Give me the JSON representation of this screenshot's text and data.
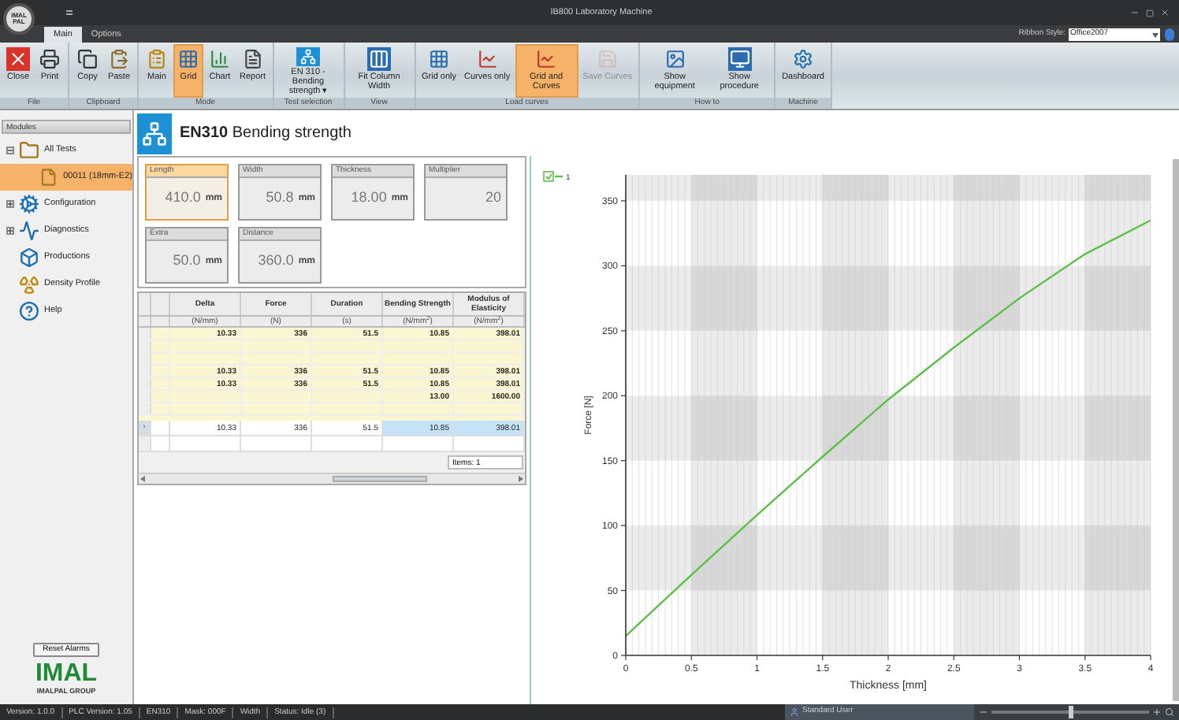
{
  "window": {
    "title": "IB800 Laboratory Machine",
    "logo": [
      "IMAL",
      "PAL"
    ]
  },
  "tabs": [
    {
      "label": "Main",
      "selected": true
    },
    {
      "label": "Options",
      "selected": false
    }
  ],
  "ribbon_style": {
    "label": "Ribbon Style:",
    "value": "Office2007"
  },
  "ribbon": [
    {
      "label": "File",
      "buttons": [
        {
          "label": "Close",
          "selected": false,
          "disabled": false
        },
        {
          "label": "Print",
          "selected": false,
          "disabled": false
        }
      ]
    },
    {
      "label": "Clipboard",
      "buttons": [
        {
          "label": "Copy",
          "selected": false,
          "disabled": false
        },
        {
          "label": "Paste",
          "selected": false,
          "disabled": false
        }
      ]
    },
    {
      "label": "Mode",
      "buttons": [
        {
          "label": "Main",
          "selected": false,
          "disabled": false
        },
        {
          "label": "Grid",
          "selected": true,
          "disabled": false
        },
        {
          "label": "Chart",
          "selected": false,
          "disabled": false
        },
        {
          "label": "Report",
          "selected": false,
          "disabled": false
        }
      ]
    },
    {
      "label": "Test selection",
      "buttons": [
        {
          "label": "EN 310 - Bending strength ▾",
          "selected": false,
          "disabled": false
        }
      ]
    },
    {
      "label": "View",
      "buttons": [
        {
          "label": "Fit Column Width",
          "selected": false,
          "disabled": false
        }
      ]
    },
    {
      "label": "Load curves",
      "buttons": [
        {
          "label": "Grid only",
          "selected": false,
          "disabled": false
        },
        {
          "label": "Curves only",
          "selected": false,
          "disabled": false
        },
        {
          "label": "Grid and Curves",
          "selected": true,
          "disabled": false
        },
        {
          "label": "Save Curves",
          "selected": false,
          "disabled": true
        }
      ]
    },
    {
      "label": "How to",
      "buttons": [
        {
          "label": "Show equipment",
          "selected": false,
          "disabled": false
        },
        {
          "label": "Show procedure",
          "selected": false,
          "disabled": false
        }
      ]
    },
    {
      "label": "Machine",
      "buttons": [
        {
          "label": "Dashboard",
          "selected": false,
          "disabled": false
        }
      ]
    }
  ],
  "sidebar": {
    "title": "Modules",
    "items": [
      {
        "label": "All Tests",
        "expanded": true,
        "children": [
          {
            "label": "00011 (18mm-E2)",
            "selected": true
          }
        ]
      },
      {
        "label": "Configuration",
        "expanded": false
      },
      {
        "label": "Diagnostics",
        "expanded": false
      },
      {
        "label": "Productions"
      },
      {
        "label": "Density Profile"
      },
      {
        "label": "Help"
      }
    ],
    "reset_button": "Reset Alarms",
    "brand": "IMAL",
    "brand_group": "IMALPAL GROUP"
  },
  "heading": {
    "code": "EN310",
    "title": "Bending strength"
  },
  "parameters": [
    [
      {
        "label": "Length",
        "value": "410.0",
        "unit": "mm",
        "selected": true
      },
      {
        "label": "Width",
        "value": "50.8",
        "unit": "mm",
        "selected": false
      },
      {
        "label": "Thickness",
        "value": "18.00",
        "unit": "mm",
        "selected": false
      },
      {
        "label": "Multiplier",
        "value": "20",
        "selected": false
      }
    ],
    [
      {
        "label": "Extra",
        "value": "50.0",
        "unit": "mm",
        "selected": false
      },
      {
        "label": "Distance",
        "value": "360.0",
        "unit": "mm",
        "selected": false
      }
    ]
  ],
  "table": {
    "columns": [
      {
        "name": "Delta",
        "unit": "(N/mm)"
      },
      {
        "name": "Force",
        "unit": "(N)"
      },
      {
        "name": "Duration",
        "unit": "(s)"
      },
      {
        "name": "Bending Strength",
        "unit": "(N/mm$^{2}$)"
      },
      {
        "name": "Modulus of Elasticity",
        "unit": "(N/mm$^{2}$)"
      }
    ],
    "summary_rows": [
      [
        "10.33",
        "336",
        "51.5",
        "10.85",
        "398.01"
      ],
      [],
      [],
      [
        "10.33",
        "336",
        "51.5",
        "10.85",
        "398.01"
      ],
      [
        "10.33",
        "336",
        "51.5",
        "10.85",
        "398.01"
      ],
      [
        "",
        "",
        "",
        "13.00",
        "1600.00"
      ],
      []
    ],
    "rows": [
      {
        "cells": [
          "10.33",
          "336",
          "51.5",
          "10.85",
          "398.01"
        ],
        "selected": true,
        "marker": "›"
      },
      {
        "cells": [],
        "selected": false
      }
    ],
    "footer": "Items: 1"
  },
  "chart_data": {
    "type": "line",
    "xlabel": "Thickness [mm]",
    "ylabel": "Force [N]",
    "x": [
      0,
      0.5,
      1,
      1.5,
      2,
      2.5,
      3,
      3.5,
      4
    ],
    "series": [
      {
        "name": "1",
        "color": "#5cbf4a",
        "values": [
          15,
          62,
          108,
          153,
          197,
          237,
          275,
          309,
          335
        ]
      }
    ],
    "xlim": [
      0,
      4
    ],
    "ylim": [
      0,
      370
    ],
    "xticks": [
      0,
      0.5,
      1,
      1.5,
      2,
      2.5,
      3,
      3.5,
      4
    ],
    "yticks": [
      0,
      50,
      100,
      150,
      200,
      250,
      300,
      350
    ],
    "grid": true
  },
  "legend": {
    "checked": true
  },
  "status_bar": {
    "items": [
      "Version: 1.0.0",
      "PLC Version: 1.05",
      "EN310",
      "Mask: 000F",
      "Width",
      "Status: Idle (3)"
    ],
    "user": "Standard User",
    "zoom": {
      "level": 0.5
    }
  }
}
